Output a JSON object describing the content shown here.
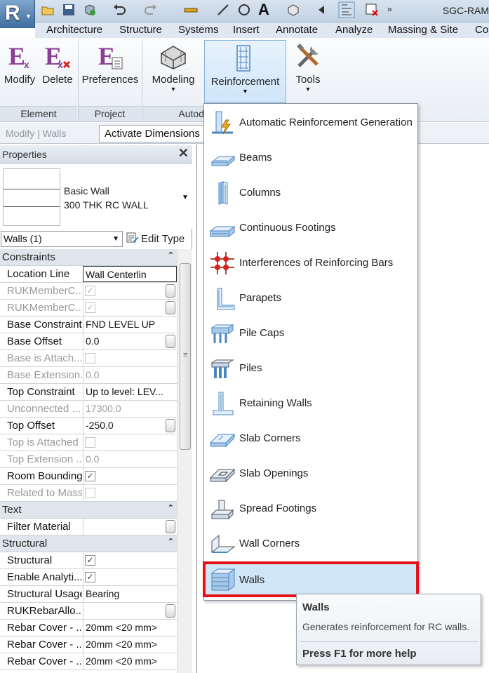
{
  "qat": {
    "title": "SGC-RAM"
  },
  "app_button": {
    "letter": "R"
  },
  "tabs": [
    "Architecture",
    "Structure",
    "Systems",
    "Insert",
    "Annotate",
    "Analyze",
    "Massing & Site",
    "Co"
  ],
  "ribbon": {
    "buttons": {
      "modify": "Modify",
      "delete": "Delete",
      "preferences": "Preferences",
      "modeling": "Modeling",
      "reinforcement": "Reinforcement",
      "tools": "Tools"
    },
    "panels": {
      "element": "Element",
      "project": "Project",
      "autod": "Autod"
    }
  },
  "options_bar": {
    "context": "Modify | Walls",
    "activate_dimensions": "Activate Dimensions"
  },
  "properties": {
    "title": "Properties",
    "close": "✕",
    "type_family": "Basic Wall",
    "type_name": "300 THK RC WALL",
    "filter": "Walls (1)",
    "edit_type": "Edit Type",
    "groups": {
      "constraints": "Constraints",
      "text": "Text",
      "structural": "Structural"
    },
    "constraints": [
      {
        "name": "Location Line",
        "value": "Wall Centerlin"
      },
      {
        "name": "RUKMemberC...",
        "value": ""
      },
      {
        "name": "RUKMemberC...",
        "value": ""
      },
      {
        "name": "Base Constraint",
        "value": "FND LEVEL UP"
      },
      {
        "name": "Base Offset",
        "value": "0.0"
      },
      {
        "name": "Base is Attach...",
        "value": ""
      },
      {
        "name": "Base Extension...",
        "value": "0.0"
      },
      {
        "name": "Top Constraint",
        "value": "Up to level: LEV..."
      },
      {
        "name": "Unconnected ...",
        "value": "17300.0"
      },
      {
        "name": "Top Offset",
        "value": "-250.0"
      },
      {
        "name": "Top is Attached",
        "value": ""
      },
      {
        "name": "Top Extension ...",
        "value": "0.0"
      },
      {
        "name": "Room Bounding",
        "value": ""
      },
      {
        "name": "Related to Mass",
        "value": ""
      }
    ],
    "text_rows": [
      {
        "name": "Filter Material",
        "value": ""
      }
    ],
    "structural_rows": [
      {
        "name": "Structural",
        "value": ""
      },
      {
        "name": "Enable Analyti...",
        "value": ""
      },
      {
        "name": "Structural Usage",
        "value": "Bearing"
      },
      {
        "name": "RUKRebarAllo...",
        "value": ""
      },
      {
        "name": "Rebar Cover - ...",
        "value": "20mm <20 mm>"
      },
      {
        "name": "Rebar Cover - ...",
        "value": "20mm <20 mm>"
      },
      {
        "name": "Rebar Cover - ...",
        "value": "20mm <20 mm>"
      }
    ],
    "check_mark": "✓"
  },
  "menu": {
    "items": [
      "Automatic Reinforcement Generation",
      "Beams",
      "Columns",
      "Continuous Footings",
      "Interferences of Reinforcing Bars",
      "Parapets",
      "Pile Caps",
      "Piles",
      "Retaining Walls",
      "Slab Corners",
      "Slab Openings",
      "Spread Footings",
      "Wall Corners",
      "Walls"
    ],
    "highlighted": "Walls"
  },
  "tooltip": {
    "title": "Walls",
    "description": "Generates reinforcement for RC walls.",
    "help": "Press F1 for more help"
  },
  "colors": {
    "accent": "#cfe6f7",
    "highlight_border": "#e3121a",
    "ribbon_purple": "#8b3d96",
    "icon_blue": "#4a86c5"
  }
}
